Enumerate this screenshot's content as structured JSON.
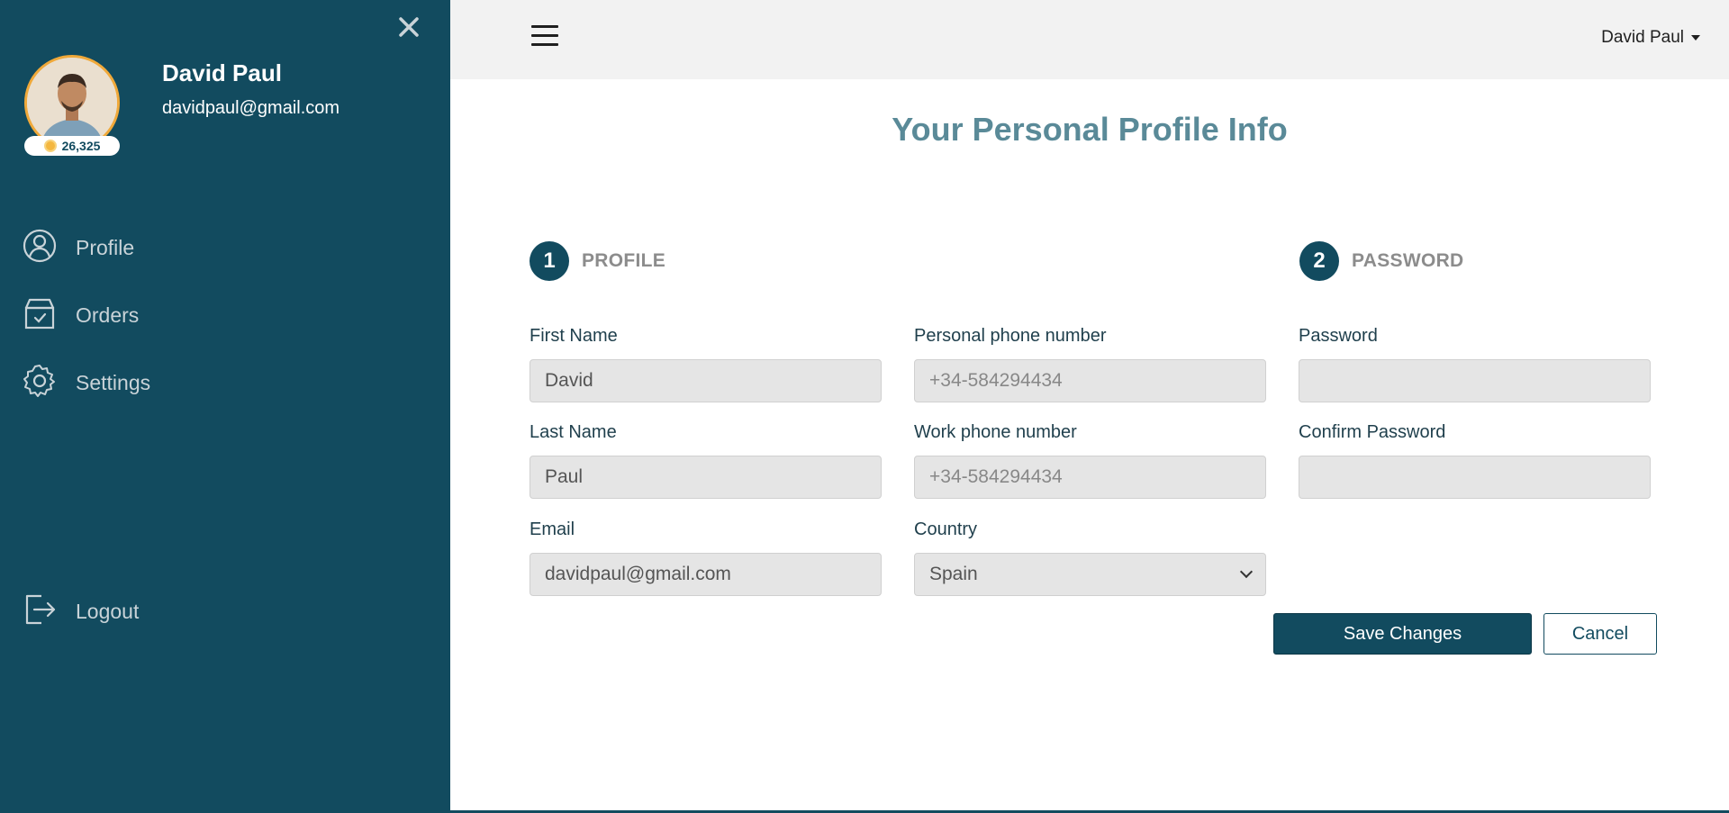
{
  "sidebar": {
    "user_name": "David Paul",
    "user_email": "davidpaul@gmail.com",
    "coins": "26,325",
    "nav": {
      "profile": "Profile",
      "orders": "Orders",
      "settings": "Settings",
      "logout": "Logout"
    }
  },
  "topbar": {
    "user_menu": "David Paul"
  },
  "main": {
    "title": "Your Personal Profile Info",
    "steps": [
      {
        "number": "1",
        "label": "PROFILE"
      },
      {
        "number": "2",
        "label": "PASSWORD"
      }
    ],
    "fields": {
      "first_name": {
        "label": "First Name",
        "value": "David"
      },
      "last_name": {
        "label": "Last Name",
        "value": "Paul"
      },
      "email": {
        "label": "Email",
        "value": "davidpaul@gmail.com"
      },
      "personal_phone": {
        "label": "Personal phone number",
        "placeholder": "+34-584294434"
      },
      "work_phone": {
        "label": "Work phone number",
        "placeholder": "+34-584294434"
      },
      "country": {
        "label": "Country",
        "value": "Spain"
      },
      "password": {
        "label": "Password",
        "value": ""
      },
      "confirm_password": {
        "label": "Confirm Password",
        "value": ""
      }
    },
    "buttons": {
      "save": "Save Changes",
      "cancel": "Cancel"
    }
  },
  "colors": {
    "sidebar_bg": "#124b5f",
    "title": "#5a8a98",
    "field_bg": "#e5e5e5"
  }
}
